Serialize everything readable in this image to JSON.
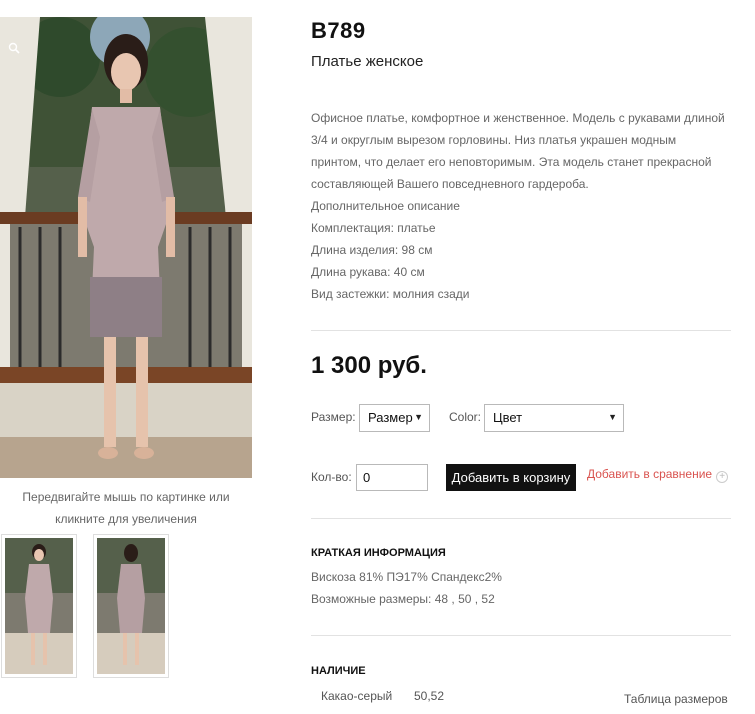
{
  "product": {
    "sku": "B789",
    "name": "Платье женское",
    "description": [
      "Офисное платье, комфортное и женственное. Модель с рукавами длиной",
      "3/4 и округлым вырезом горловины. Низ платья украшен модным",
      "принтом, что делает его неповторимым. Эта модель станет прекрасной",
      "составляющей Вашего повседневного гардероба.",
      "Дополнительное описание",
      "Комплектация: платье",
      "Длина изделия: 98 см",
      "Длина рукава: 40 см",
      "Вид застежки: молния сзади"
    ],
    "price": "1 300 руб."
  },
  "gallery": {
    "hint_line1": "Передвигайте мышь по картинке или",
    "hint_line2": "кликните для увеличения"
  },
  "options": {
    "size_label": "Размер:",
    "size_value": "Размер",
    "color_label": "Color:",
    "color_value": "Цвет"
  },
  "cart": {
    "qty_label": "Кол-во:",
    "qty_value": "0",
    "add_button": "Добавить в корзину",
    "compare_link": "Добавить в сравнение",
    "compare_icon": "+"
  },
  "brief": {
    "title": "КРАТКАЯ ИНФОРМАЦИЯ",
    "composition": "Вискоза 81% ПЭ17% Спандекс2%",
    "sizes": "Возможные размеры: 48 , 50 , 52"
  },
  "availability": {
    "title": "НАЛИЧИЕ",
    "color": "Какао-серый",
    "sizes": "50,52",
    "size_table_link": "Таблица размеров"
  },
  "colors": {
    "accent": "#d9534f",
    "button_bg": "#111111",
    "dress": "#bfa9ab"
  },
  "icons": {
    "zoom": "magnifier-icon",
    "compare": "plus-circle-icon"
  }
}
